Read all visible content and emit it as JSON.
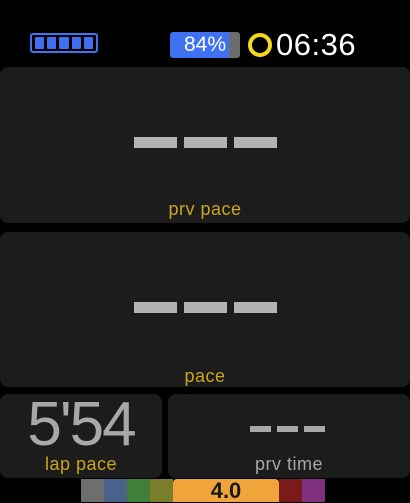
{
  "status": {
    "battery_percent_text": "84%",
    "battery_level": 0.84,
    "battery_strip_segments": 5,
    "clock": "06:36",
    "accent_blue": "#3f72f0",
    "ring_color": "#f4d81c"
  },
  "fields": {
    "prv_pace": {
      "value": "---",
      "label": "prv pace"
    },
    "pace": {
      "value": "---",
      "label": "pace"
    },
    "lap_pace": {
      "value": "5'54",
      "label": "lap pace"
    },
    "prv_time": {
      "value": "---",
      "label": "prv time"
    }
  },
  "label_color": "#c9a41f",
  "zone_bar": {
    "current_value": "4.0",
    "zones": [
      {
        "name": "zone-1",
        "color": "#6e6e6e"
      },
      {
        "name": "zone-2",
        "color": "#4a6189"
      },
      {
        "name": "zone-3",
        "color": "#3f7f3a"
      },
      {
        "name": "zone-4",
        "color": "#7a7e2a"
      },
      {
        "name": "zone-current",
        "color": "#f0a43a"
      },
      {
        "name": "zone-6",
        "color": "#7b1a1a"
      },
      {
        "name": "zone-7",
        "color": "#7f3080"
      }
    ]
  }
}
